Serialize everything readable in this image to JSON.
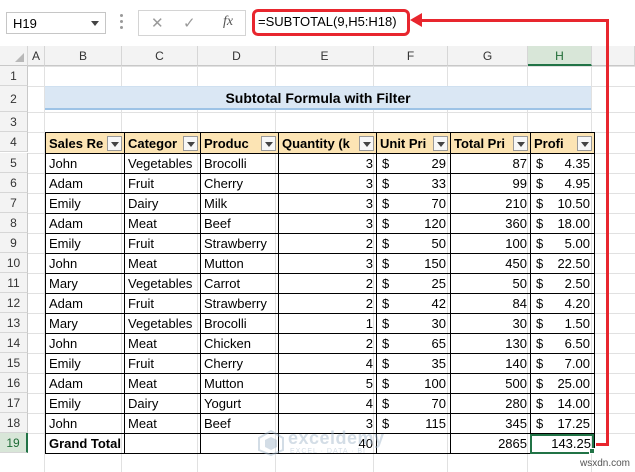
{
  "formula_bar": {
    "name_box": "H19",
    "formula": "=SUBTOTAL(9,H5:H18)",
    "cancel_icon": "✕",
    "enter_icon": "✓",
    "fx_label": "fx"
  },
  "columns": [
    "A",
    "B",
    "C",
    "D",
    "E",
    "F",
    "G",
    "H"
  ],
  "selected_column": "H",
  "selected_row": 19,
  "rows": [
    1,
    2,
    3,
    4,
    5,
    6,
    7,
    8,
    9,
    10,
    11,
    12,
    13,
    14,
    15,
    16,
    17,
    18,
    19
  ],
  "title": "Subtotal Formula with Filter",
  "table": {
    "headers": [
      "Sales Re",
      "Categor",
      "Produc",
      "Quantity (k",
      "Unit Pri",
      "Total Pri",
      "Profi"
    ],
    "currency": "$",
    "rows": [
      [
        "John",
        "Vegetables",
        "Brocolli",
        "3",
        "29",
        "87",
        "4.35"
      ],
      [
        "Adam",
        "Fruit",
        "Cherry",
        "3",
        "33",
        "99",
        "4.95"
      ],
      [
        "Emily",
        "Dairy",
        "Milk",
        "3",
        "70",
        "210",
        "10.50"
      ],
      [
        "Adam",
        "Meat",
        "Beef",
        "3",
        "120",
        "360",
        "18.00"
      ],
      [
        "Emily",
        "Fruit",
        "Strawberry",
        "2",
        "50",
        "100",
        "5.00"
      ],
      [
        "John",
        "Meat",
        "Mutton",
        "3",
        "150",
        "450",
        "22.50"
      ],
      [
        "Mary",
        "Vegetables",
        "Carrot",
        "2",
        "25",
        "50",
        "2.50"
      ],
      [
        "Adam",
        "Fruit",
        "Strawberry",
        "2",
        "42",
        "84",
        "4.20"
      ],
      [
        "Mary",
        "Vegetables",
        "Brocolli",
        "1",
        "30",
        "30",
        "1.50"
      ],
      [
        "John",
        "Meat",
        "Chicken",
        "2",
        "65",
        "130",
        "6.50"
      ],
      [
        "Emily",
        "Fruit",
        "Cherry",
        "4",
        "35",
        "140",
        "7.00"
      ],
      [
        "Adam",
        "Meat",
        "Mutton",
        "5",
        "100",
        "500",
        "25.00"
      ],
      [
        "Emily",
        "Dairy",
        "Yogurt",
        "4",
        "70",
        "280",
        "14.00"
      ],
      [
        "John",
        "Meat",
        "Beef",
        "3",
        "115",
        "345",
        "17.25"
      ]
    ],
    "grand_total": {
      "label": "Grand Total",
      "quantity": "40",
      "total_price": "2865",
      "profit": "143.25"
    }
  },
  "watermark": {
    "name": "exceldemy",
    "tagline": "EXCEL · DATA · BI"
  },
  "url_text": "wsxdn.com",
  "colors": {
    "highlight_red": "#e8262e",
    "header_fill": "#fce4b4",
    "title_fill": "#dae7f4",
    "excel_green": "#217346"
  }
}
